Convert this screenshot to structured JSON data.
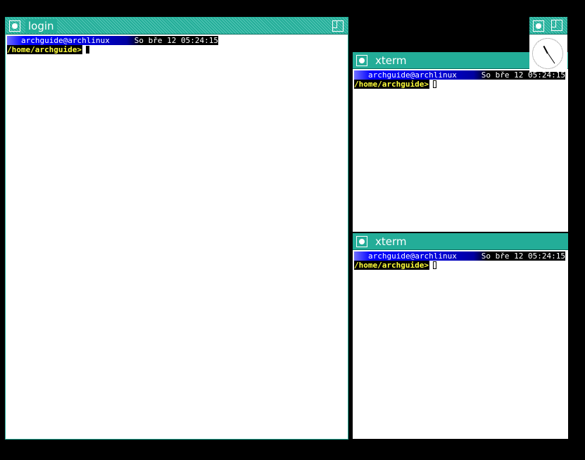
{
  "windows": {
    "login": {
      "title": "login",
      "status_user": "archguide@archlinux",
      "status_date": "So bře 12 05:24:15",
      "prompt": "/home/archguide>"
    },
    "xterm_top": {
      "title": "xterm",
      "status_user": "archguide@archlinux",
      "status_date": "So bře 12 05:24:15",
      "prompt": "/home/archguide>"
    },
    "xterm_bottom": {
      "title": "xterm",
      "status_user": "archguide@archlinux",
      "status_date": "So bře 12 05:24:15",
      "prompt": "/home/archguide>"
    }
  },
  "clock": {
    "time": "05:24:15"
  },
  "colors": {
    "titlebar": "#23ad98",
    "desktop": "#000000",
    "prompt_text": "#ffff3a",
    "status_start": "#6f6fff",
    "status_mid": "#0000ff"
  },
  "icons": {
    "iconify": "iconify-button-icon",
    "resize": "resize-button-icon",
    "clock": "analog-clock-icon"
  }
}
